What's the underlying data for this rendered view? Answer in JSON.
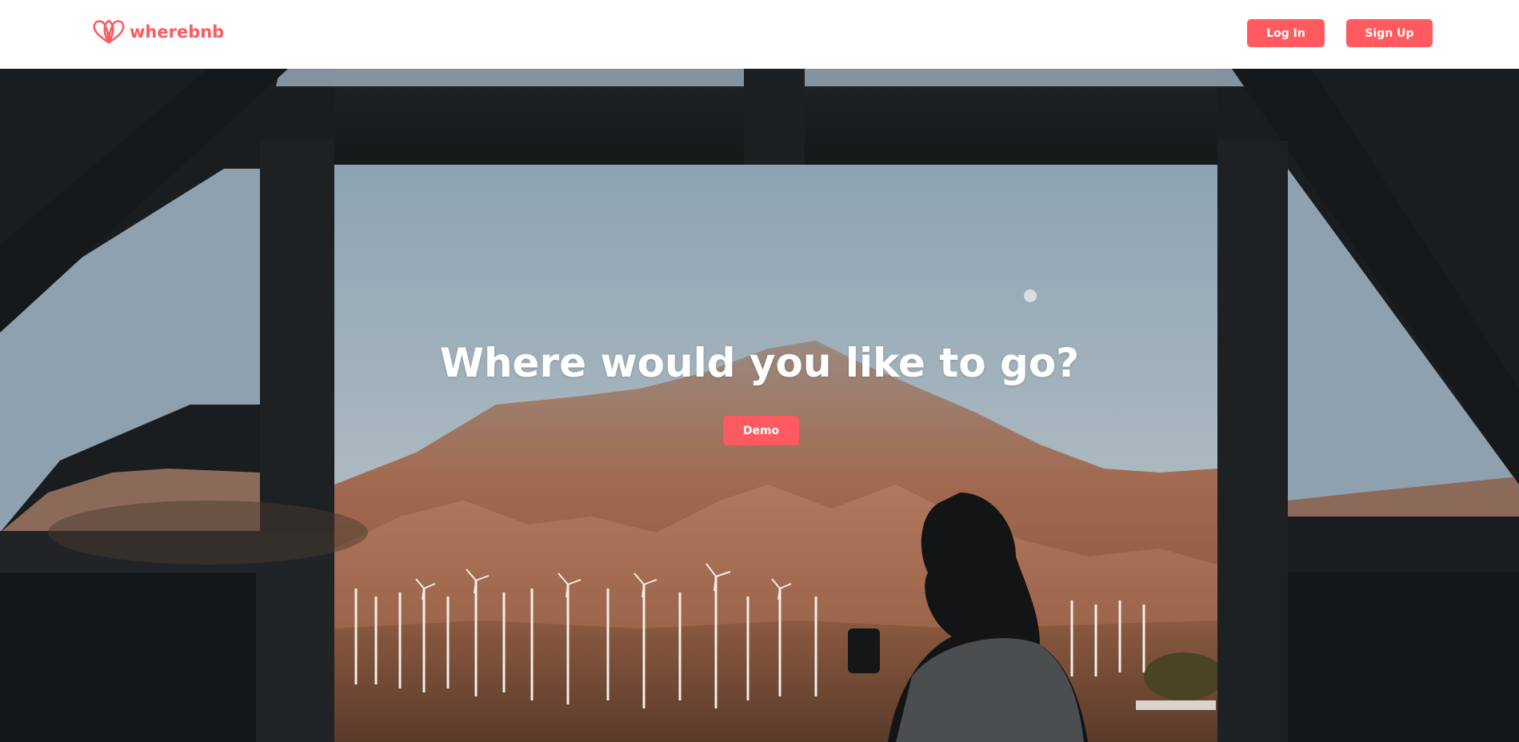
{
  "header": {
    "logo_text": "wherebnb",
    "logo_icon": "wherebnb-logo-icon",
    "login_label": "Log In",
    "signup_label": "Sign Up"
  },
  "hero": {
    "title": "Where would you like to go?",
    "demo_label": "Demo",
    "background_image": "woman-at-window-mountain-view-photo"
  },
  "colors": {
    "brand": "#ff5a5f",
    "header_bg": "#ffffff",
    "text_on_brand": "#ffffff"
  }
}
